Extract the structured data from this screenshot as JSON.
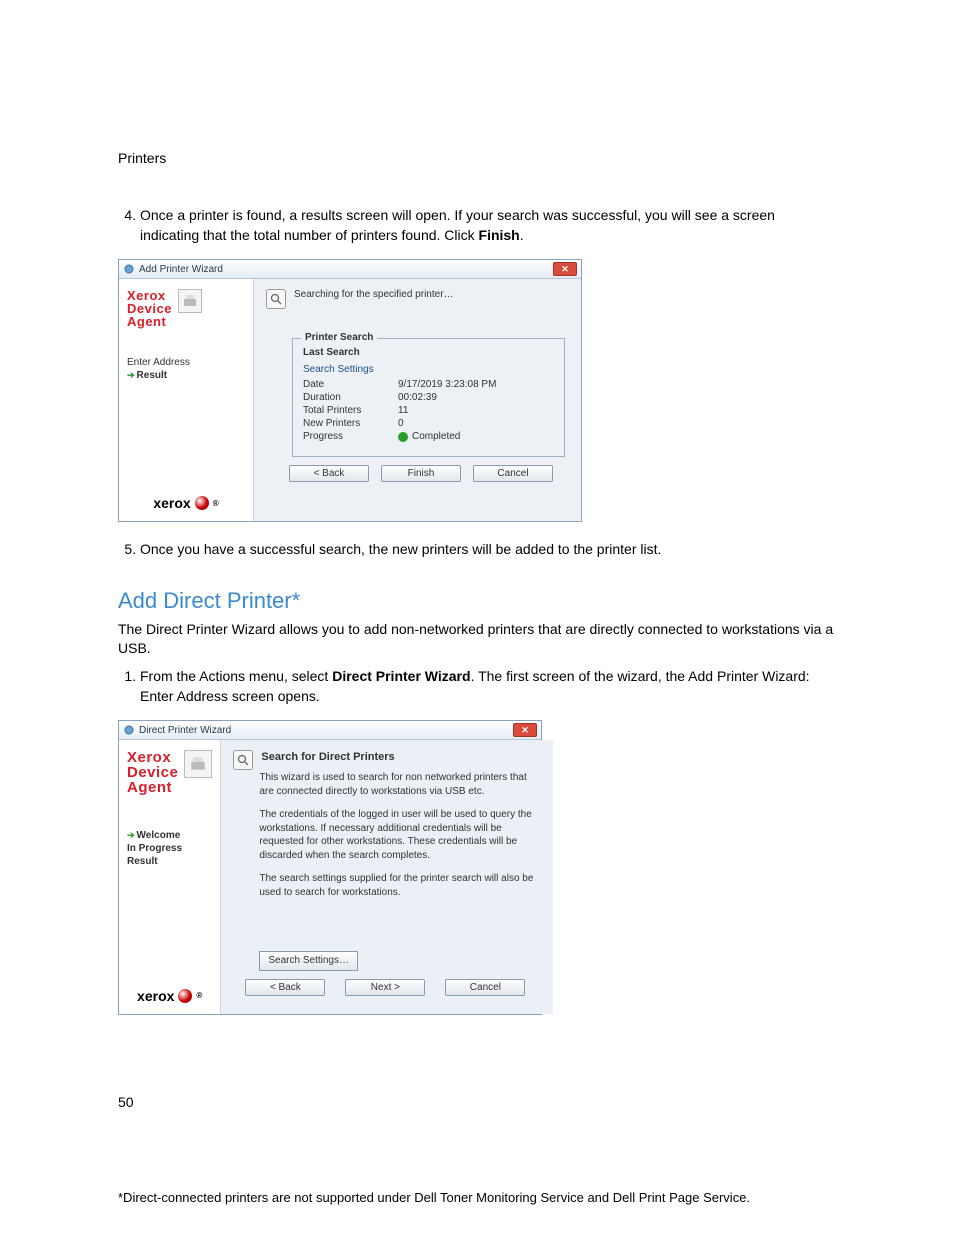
{
  "header": {
    "label": "Printers"
  },
  "list4": {
    "number": "4",
    "text_a": "Once a printer is found, a results screen will open. If your search was successful, you will see a screen indicating that the total number of printers found. Click ",
    "text_bold": "Finish",
    "text_b": "."
  },
  "wizard1": {
    "title": "Add Printer Wizard",
    "brand_line1": "Xerox",
    "brand_line2": "Device",
    "brand_line3": "Agent",
    "steps": {
      "s1": "Enter Address",
      "s2": "Result"
    },
    "xerox_label": "xerox",
    "headline": "Searching for the specified printer…",
    "fieldset_legend": "Printer Search",
    "subhead": "Last Search",
    "link": "Search Settings",
    "rows": {
      "date_k": "Date",
      "date_v": "9/17/2019 3:23:08 PM",
      "dur_k": "Duration",
      "dur_v": "00:02:39",
      "total_k": "Total Printers",
      "total_v": "11",
      "new_k": "New Printers",
      "new_v": "0",
      "prog_k": "Progress",
      "prog_v": "Completed"
    },
    "buttons": {
      "back": "< Back",
      "finish": "Finish",
      "cancel": "Cancel"
    }
  },
  "list5": {
    "number": "5",
    "text": "Once you have a successful search, the new printers will be added to the printer list."
  },
  "section": {
    "heading": "Add Direct Printer*",
    "para": "The Direct Printer Wizard allows you to add non-networked printers that are directly connected to workstations via a USB."
  },
  "list1b": {
    "number": "1",
    "text_a": "From the Actions menu, select ",
    "text_bold": "Direct Printer Wizard",
    "text_b": ". The first screen of the wizard, the Add Printer Wizard: Enter Address screen opens."
  },
  "wizard2": {
    "title": "Direct Printer Wizard",
    "brand_line1": "Xerox",
    "brand_line2": "Device",
    "brand_line3": "Agent",
    "steps": {
      "s1": "Welcome",
      "s2": "In Progress",
      "s3": "Result"
    },
    "xerox_label": "xerox",
    "main_title": "Search for Direct Printers",
    "p1": "This wizard is used to search for non networked printers that are connected directly to workstations via USB etc.",
    "p2": "The credentials of the logged in user will be used to query the workstations. If necessary additional credentials will be requested for other workstations. These credentials will be discarded when the search completes.",
    "p3": "The search settings supplied for the printer search will also be used to search for workstations.",
    "search_settings": "Search Settings…",
    "buttons": {
      "back": "< Back",
      "next": "Next >",
      "cancel": "Cancel"
    }
  },
  "page_number": "50",
  "footnote": "*Direct-connected printers are not supported under Dell Toner Monitoring Service and Dell Print Page Service."
}
